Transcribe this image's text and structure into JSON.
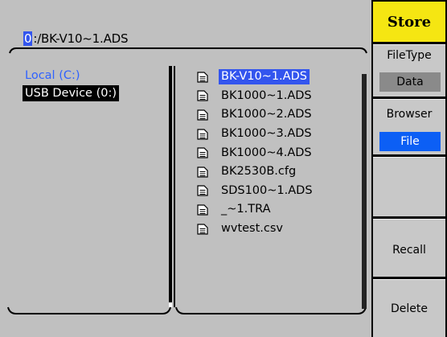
{
  "path_bar": {
    "drive_letter": "0",
    "path_rest": ":/BK-V10~1.ADS"
  },
  "drives": [
    {
      "label": "Local (C:)",
      "state": "normal"
    },
    {
      "label": "USB Device (0:)",
      "state": "highlighted"
    }
  ],
  "files": [
    {
      "name": "BK-V10~1.ADS",
      "icon": "document-icon",
      "selected": true
    },
    {
      "name": "BK1000~1.ADS",
      "icon": "document-icon"
    },
    {
      "name": "BK1000~2.ADS",
      "icon": "document-icon"
    },
    {
      "name": "BK1000~3.ADS",
      "icon": "document-icon"
    },
    {
      "name": "BK1000~4.ADS",
      "icon": "document-icon"
    },
    {
      "name": "BK2530B.cfg",
      "icon": "document-icon"
    },
    {
      "name": "SDS100~1.ADS",
      "icon": "document-icon"
    },
    {
      "name": "_~1.TRA",
      "icon": "document-icon"
    },
    {
      "name": "wvtest.csv",
      "icon": "document-icon"
    }
  ],
  "menu": {
    "title": "Store",
    "filetype": {
      "label": "FileType",
      "value": "Data"
    },
    "browser": {
      "label": "Browser",
      "value": "File"
    },
    "blank": {
      "label": ""
    },
    "recall": {
      "label": "Recall"
    },
    "delete": {
      "label": "Delete"
    }
  },
  "colors": {
    "background": "#c0c0c0",
    "selection": "#3355ee",
    "local_drive_text": "#2f62ff",
    "menu_title": "#f5e612",
    "browser_value": "#0c5ff5",
    "filetype_value": "#8a8a8a"
  }
}
